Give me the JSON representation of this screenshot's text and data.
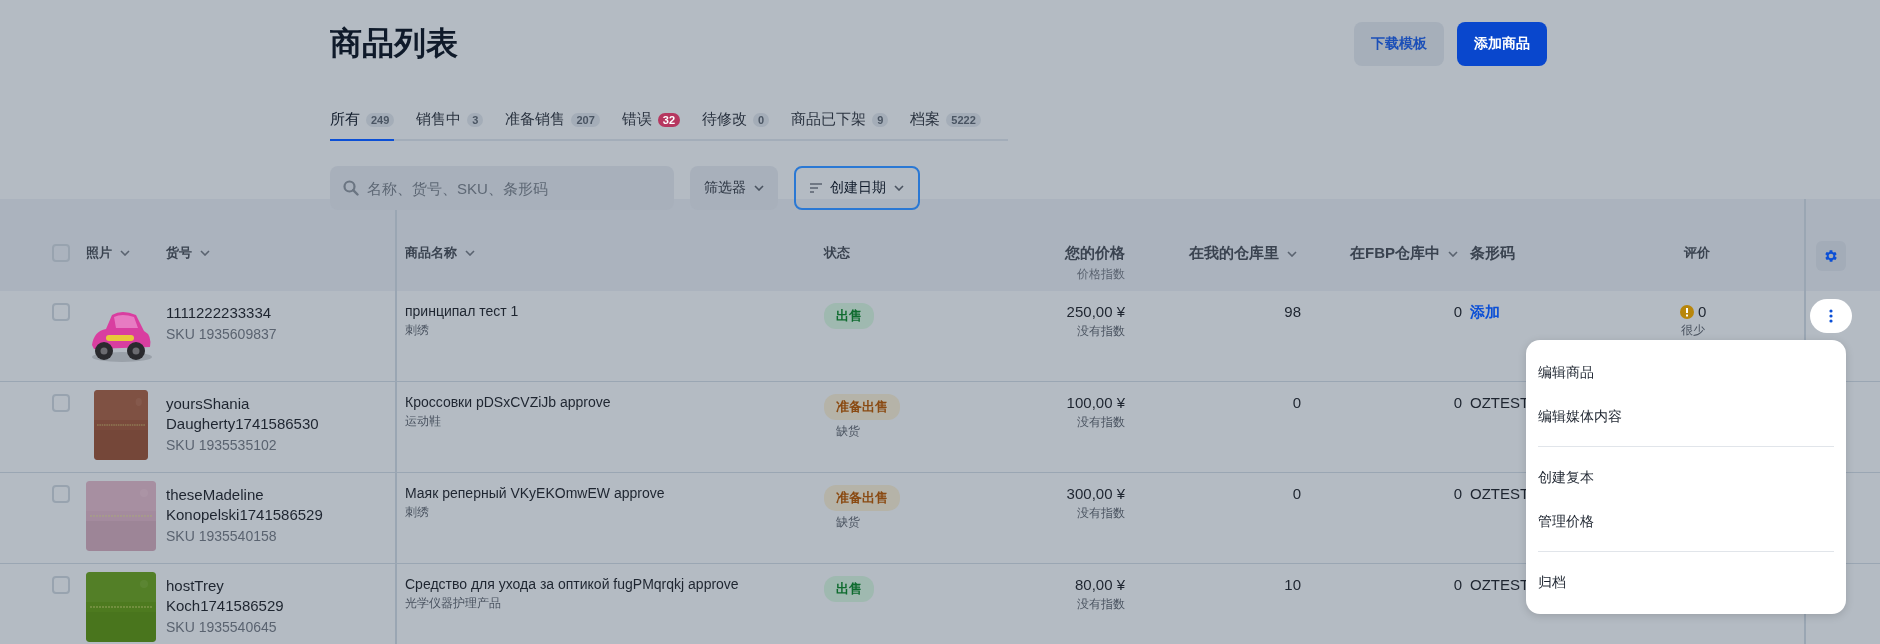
{
  "page_title": "商品列表",
  "buttons": [
    {
      "label": "下载模板",
      "kind": "secondary"
    },
    {
      "label": "添加商品",
      "kind": "primary"
    }
  ],
  "tabs": [
    {
      "label": "所有",
      "count": "249",
      "selected": true,
      "alert": false
    },
    {
      "label": "销售中",
      "count": "3",
      "selected": false,
      "alert": false
    },
    {
      "label": "准备销售",
      "count": "207",
      "selected": false,
      "alert": false
    },
    {
      "label": "错误",
      "count": "32",
      "selected": false,
      "alert": true
    },
    {
      "label": "待修改",
      "count": "0",
      "selected": false,
      "alert": false
    },
    {
      "label": "商品已下架",
      "count": "9",
      "selected": false,
      "alert": false
    },
    {
      "label": "档案",
      "count": "5222",
      "selected": false,
      "alert": false
    }
  ],
  "search": {
    "placeholder": "名称、货号、SKU、条形码"
  },
  "filter_button": {
    "label": "筛选器"
  },
  "sort_button": {
    "label": "创建日期"
  },
  "table": {
    "select_all": {
      "checked": false
    },
    "columns": [
      {
        "label": "照片",
        "sortable": true
      },
      {
        "label": "货号",
        "sortable": true
      },
      {
        "label": "商品名称",
        "sortable": true
      },
      {
        "label": "状态",
        "sortable": false
      },
      {
        "label": "您的价格",
        "sublabel": "价格指数",
        "sortable": false
      },
      {
        "label": "在我的仓库里",
        "sortable": true
      },
      {
        "label": "在FBP仓库中",
        "sortable": true
      },
      {
        "label": "条形码",
        "sortable": false
      },
      {
        "label": "评价",
        "sortable": false
      }
    ],
    "rows": [
      {
        "checked": false,
        "article": "1111222233334",
        "sku": "SKU 1935609837",
        "name": "принципал тест 1",
        "category": "刺绣",
        "status": {
          "label": "出售",
          "kind": "selling"
        },
        "price": "250,00 ¥",
        "price_index": "没有指数",
        "my_stock": "98",
        "fbp_stock": "0",
        "barcode": {
          "text": "添加",
          "kind": "link"
        },
        "rating": {
          "warning": true,
          "value": "0",
          "note": "很少"
        }
      },
      {
        "checked": false,
        "article": "yoursShania Daugherty1741586530",
        "sku": "SKU 1935535102",
        "name": "Кроссовки pDSxCVZiJb approve",
        "category": "运动鞋",
        "status": {
          "label": "准备出售",
          "kind": "ready"
        },
        "stock_note": "缺货",
        "price": "100,00 ¥",
        "price_index": "没有指数",
        "my_stock": "0",
        "fbp_stock": "0",
        "barcode": {
          "text": "OZTEST",
          "kind": "text"
        }
      },
      {
        "checked": false,
        "article": "theseMadeline Konopelski1741586529",
        "sku": "SKU 1935540158",
        "name": "Маяк реперный VKyEKOmwEW approve",
        "category": "刺绣",
        "status": {
          "label": "准备出售",
          "kind": "ready"
        },
        "stock_note": "缺货",
        "price": "300,00 ¥",
        "price_index": "没有指数",
        "my_stock": "0",
        "fbp_stock": "0",
        "barcode": {
          "text": "OZTEST",
          "kind": "text"
        }
      },
      {
        "checked": false,
        "article": "hostTrey Koch1741586529",
        "sku": "SKU 1935540645",
        "name": "Средство для ухода за оптикой fugPMqrqkj approve",
        "category": "光学仪器护理产品",
        "status": {
          "label": "出售",
          "kind": "selling"
        },
        "price": "80,00 ¥",
        "price_index": "没有指数",
        "my_stock": "10",
        "fbp_stock": "0",
        "barcode": {
          "text": "OZTEST",
          "kind": "text"
        }
      }
    ]
  },
  "row_menu": {
    "items": [
      {
        "label": "编辑商品",
        "divider_before": false
      },
      {
        "label": "编辑媒体内容",
        "divider_before": false
      },
      {
        "label": "创建复本",
        "divider_before": true
      },
      {
        "label": "管理价格",
        "divider_before": false
      },
      {
        "label": "归档",
        "divider_before": true
      }
    ]
  }
}
